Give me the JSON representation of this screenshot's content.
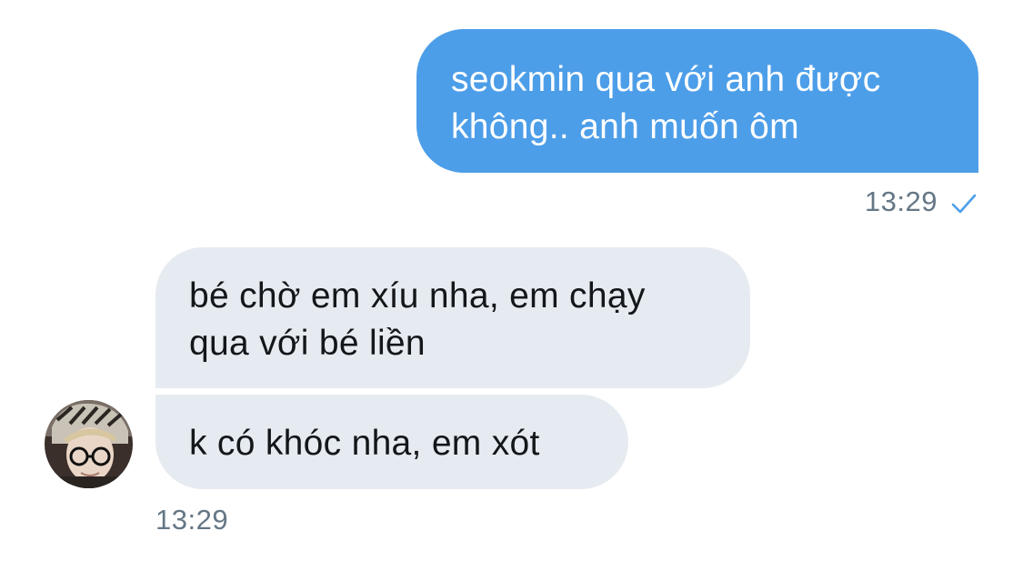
{
  "conversation": {
    "messages": [
      {
        "direction": "sent",
        "lines": [
          "seokmin qua với anh được",
          "không.. anh muốn ôm"
        ]
      },
      {
        "direction": "received",
        "lines": [
          "bé chờ em xíu nha, em chạy",
          "qua với bé liền"
        ]
      },
      {
        "direction": "received",
        "lines": [
          "k có khóc nha, em xót"
        ]
      }
    ],
    "sent_time": "13:29",
    "received_time": "13:29",
    "read_status_icon": "check-icon"
  },
  "colors": {
    "sent_bubble": "#4d9ee8",
    "received_bubble": "#e6ebf1",
    "timestamp": "#657786",
    "check": "#4d9ee8"
  },
  "avatar_icon": "user-avatar"
}
